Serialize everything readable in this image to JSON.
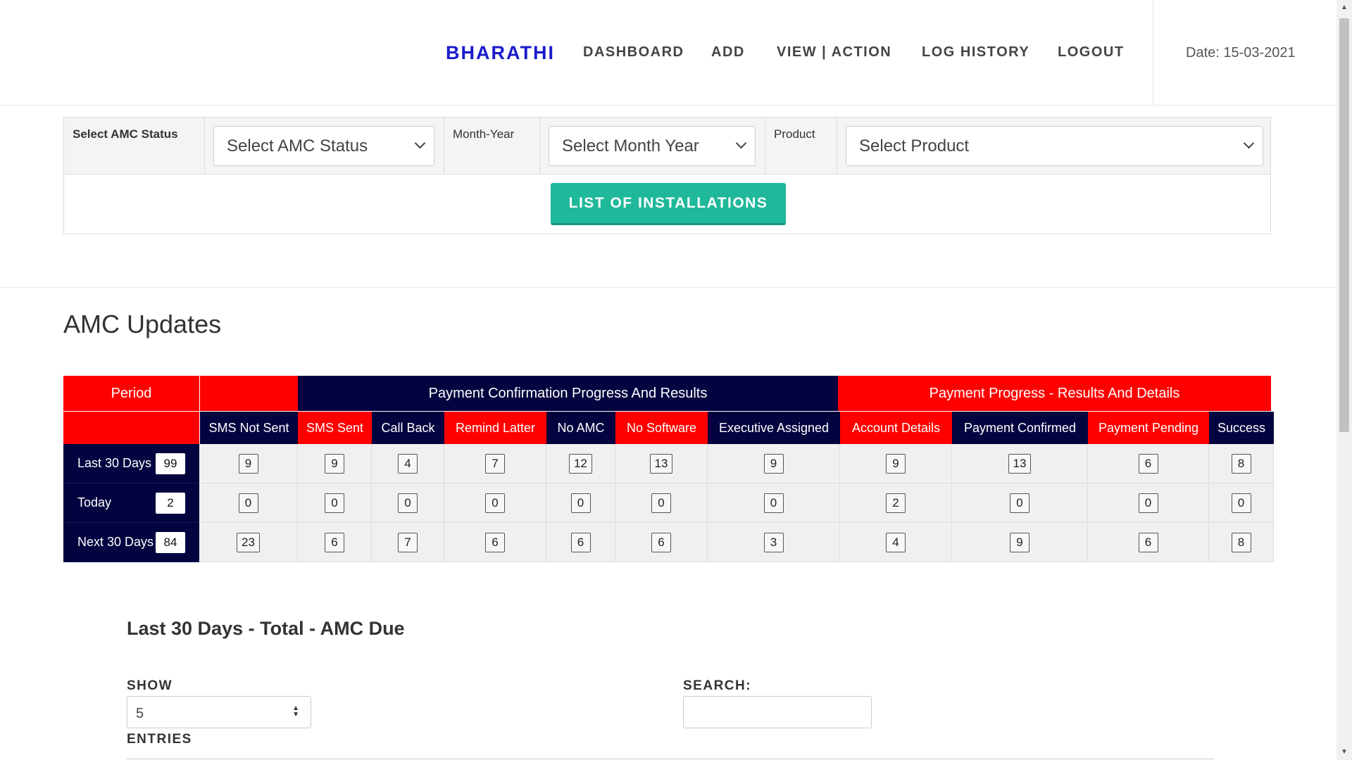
{
  "header": {
    "brand": "BHARATHI",
    "nav": [
      {
        "label": "DASHBOARD"
      },
      {
        "label": "ADD"
      },
      {
        "label": "VIEW | ACTION"
      },
      {
        "label": "LOG HISTORY"
      },
      {
        "label": "LOGOUT"
      }
    ],
    "date": "Date: 15-03-2021"
  },
  "filters": {
    "amc_status_label": "Select AMC Status",
    "amc_status_value": "Select AMC Status",
    "month_year_label": "Month-Year",
    "month_year_value": "Select Month Year",
    "product_label": "Product",
    "product_value": "Select Product",
    "list_button": "LIST OF INSTALLATIONS"
  },
  "amc_updates": {
    "title": "AMC Updates",
    "period_header": "Period",
    "group_headers": {
      "confirmation": "Payment Confirmation Progress And Results",
      "progress": "Payment Progress - Results And Details"
    },
    "columns": [
      "SMS Not Sent",
      "SMS Sent",
      "Call Back",
      "Remind Latter",
      "No AMC",
      "No Software",
      "Executive Assigned",
      "Account Details",
      "Payment Confirmed",
      "Payment Pending",
      "Success"
    ],
    "column_colors": [
      "navy",
      "red",
      "navy",
      "red",
      "navy",
      "red",
      "navy",
      "red",
      "navy",
      "red",
      "navy"
    ],
    "rows": [
      {
        "period": "Last 30 Days",
        "total": "99",
        "values": [
          "9",
          "9",
          "4",
          "7",
          "12",
          "13",
          "9",
          "9",
          "13",
          "6",
          "8"
        ]
      },
      {
        "period": "Today",
        "total": "2",
        "values": [
          "0",
          "0",
          "0",
          "0",
          "0",
          "0",
          "0",
          "2",
          "0",
          "0",
          "0"
        ]
      },
      {
        "period": "Next 30 Days",
        "total": "84",
        "values": [
          "23",
          "6",
          "7",
          "6",
          "6",
          "6",
          "3",
          "4",
          "9",
          "6",
          "8"
        ]
      }
    ]
  },
  "colors": {
    "red": "#ff0000",
    "navy": "#03033f",
    "accent": "#1fb89a",
    "brand": "#1a1acc"
  },
  "due_section": {
    "title": "Last 30 Days - Total - AMC Due",
    "show_label": "SHOW",
    "show_value": "5",
    "entries_label": "ENTRIES",
    "search_label": "SEARCH:",
    "search_value": ""
  }
}
